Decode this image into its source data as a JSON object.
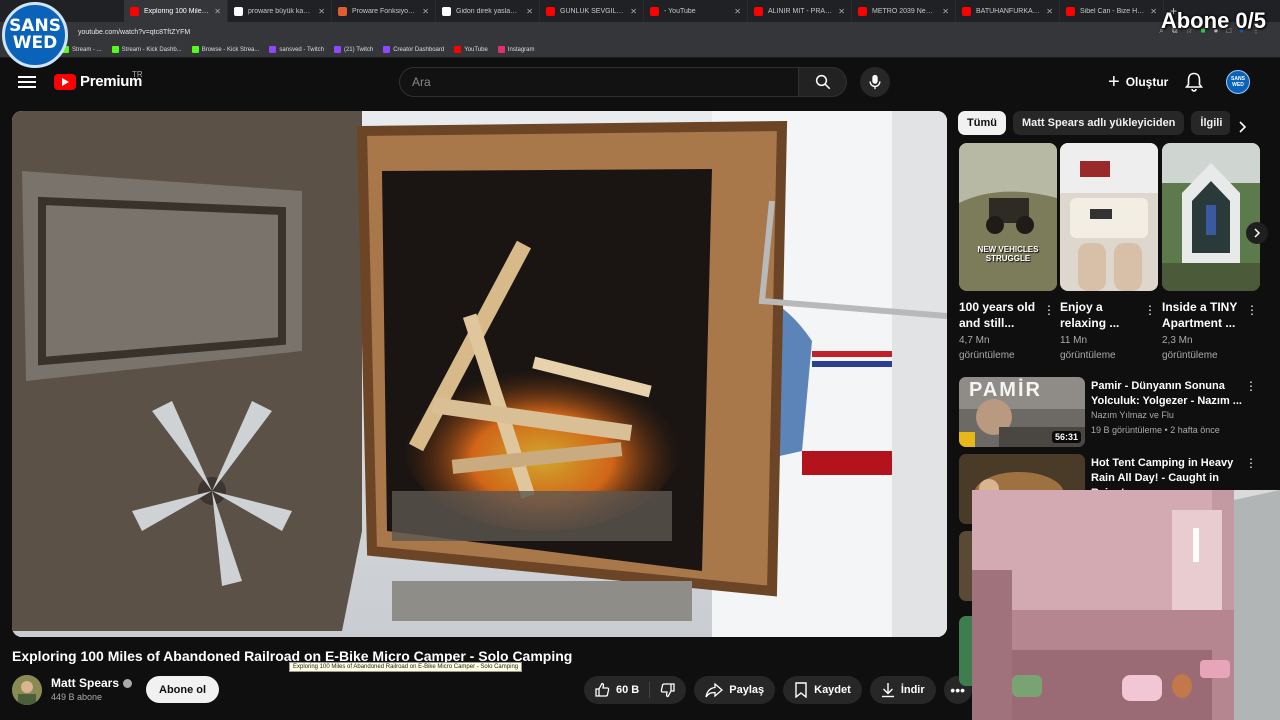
{
  "overlay": {
    "logo_text": "SANS\nWED",
    "subscriber_goal": "Abone 0/5"
  },
  "browser": {
    "tabs": [
      {
        "label": "Exploring 100 Miles o...",
        "active": true,
        "color": "#ff0000"
      },
      {
        "label": "proware büyük kamp balt...",
        "color": "#ffffff"
      },
      {
        "label": "Proware Fonksiyonel Kam...",
        "color": "#e25d2f"
      },
      {
        "label": "Gidon direk yaslama - Go...",
        "color": "#ffffff"
      },
      {
        "label": "GÜNLÜK SEVGİLİ KİRALA...",
        "color": "#ff0000"
      },
      {
        "label": "- YouTube",
        "color": "#ff0000"
      },
      {
        "label": "ALINIR MIT - PRAGMATA...",
        "color": "#ff0000"
      },
      {
        "label": "METRO 2039 New Gamepl...",
        "color": "#ff0000"
      },
      {
        "label": "BATUHANFURKANS - HÜ...",
        "color": "#ff0000"
      },
      {
        "label": "Sibel Can - Bize Has (Slow...",
        "color": "#ff0000"
      }
    ],
    "url": "youtube.com/watch?v=qtc8TftZYFM",
    "bookmarks": [
      {
        "label": "Stream - ...",
        "color": "#53fc18"
      },
      {
        "label": "Stream - Kick Dashb...",
        "color": "#53fc18"
      },
      {
        "label": "Browse - Kick Strea...",
        "color": "#53fc18"
      },
      {
        "label": "sansved - Twitch",
        "color": "#9146ff"
      },
      {
        "label": "(21) Twitch",
        "color": "#9146ff"
      },
      {
        "label": "Creator Dashboard",
        "color": "#9146ff"
      },
      {
        "label": "YouTube",
        "color": "#ff0000"
      },
      {
        "label": "Instagram",
        "color": "#e1306c"
      }
    ]
  },
  "header": {
    "logo_text": "Premium",
    "region": "TR",
    "search_placeholder": "Ara",
    "create_label": "Oluştur",
    "avatar_text": "SANS\nWED"
  },
  "video": {
    "title": "Exploring 100 Miles of Abandoned Railroad on E-Bike Micro Camper - Solo Camping",
    "tooltip": "Exploring 100 Miles of Abandoned Railroad on E-Bike Micro Camper - Solo Camping",
    "channel": "Matt Spears",
    "subscribers": "449 B abone",
    "subscribe_label": "Abone ol",
    "likes": "60 B",
    "share_label": "Paylaş",
    "save_label": "Kaydet",
    "download_label": "İndir"
  },
  "sidebar": {
    "chips": [
      {
        "label": "Tümü",
        "active": true
      },
      {
        "label": "Matt Spears adlı yükleyiciden"
      },
      {
        "label": "İlgili"
      }
    ],
    "shorts": [
      {
        "title": "100 years old and still...",
        "views": "4,7 Mn",
        "views_label": "görüntüleme",
        "overlay_text": "NEW VEHICLES STRUGGLE"
      },
      {
        "title": "Enjoy a relaxing ...",
        "views": "11 Mn",
        "views_label": "görüntüleme"
      },
      {
        "title": "Inside a TINY Apartment ...",
        "views": "2,3 Mn",
        "views_label": "görüntüleme"
      }
    ],
    "recommendations": [
      {
        "title": "Pamir - Dünyanın Sonuna Yolculuk: Yolgezer - Nazım ...",
        "channel": "Nazım Yılmaz ve Flu",
        "stats": "19 B görüntüleme • 2 hafta önce",
        "duration": "56:31",
        "thumb_text": "PAMİR"
      },
      {
        "title": "Hot Tent Camping in Heavy Rain All Day! - Caught in Rainstorm ...",
        "channel": "",
        "stats": "",
        "duration": ""
      }
    ]
  },
  "colors": {
    "bg": "#0f0f0f",
    "accent_red": "#ff0000",
    "pill": "#272727",
    "text_secondary": "#aaaaaa"
  }
}
